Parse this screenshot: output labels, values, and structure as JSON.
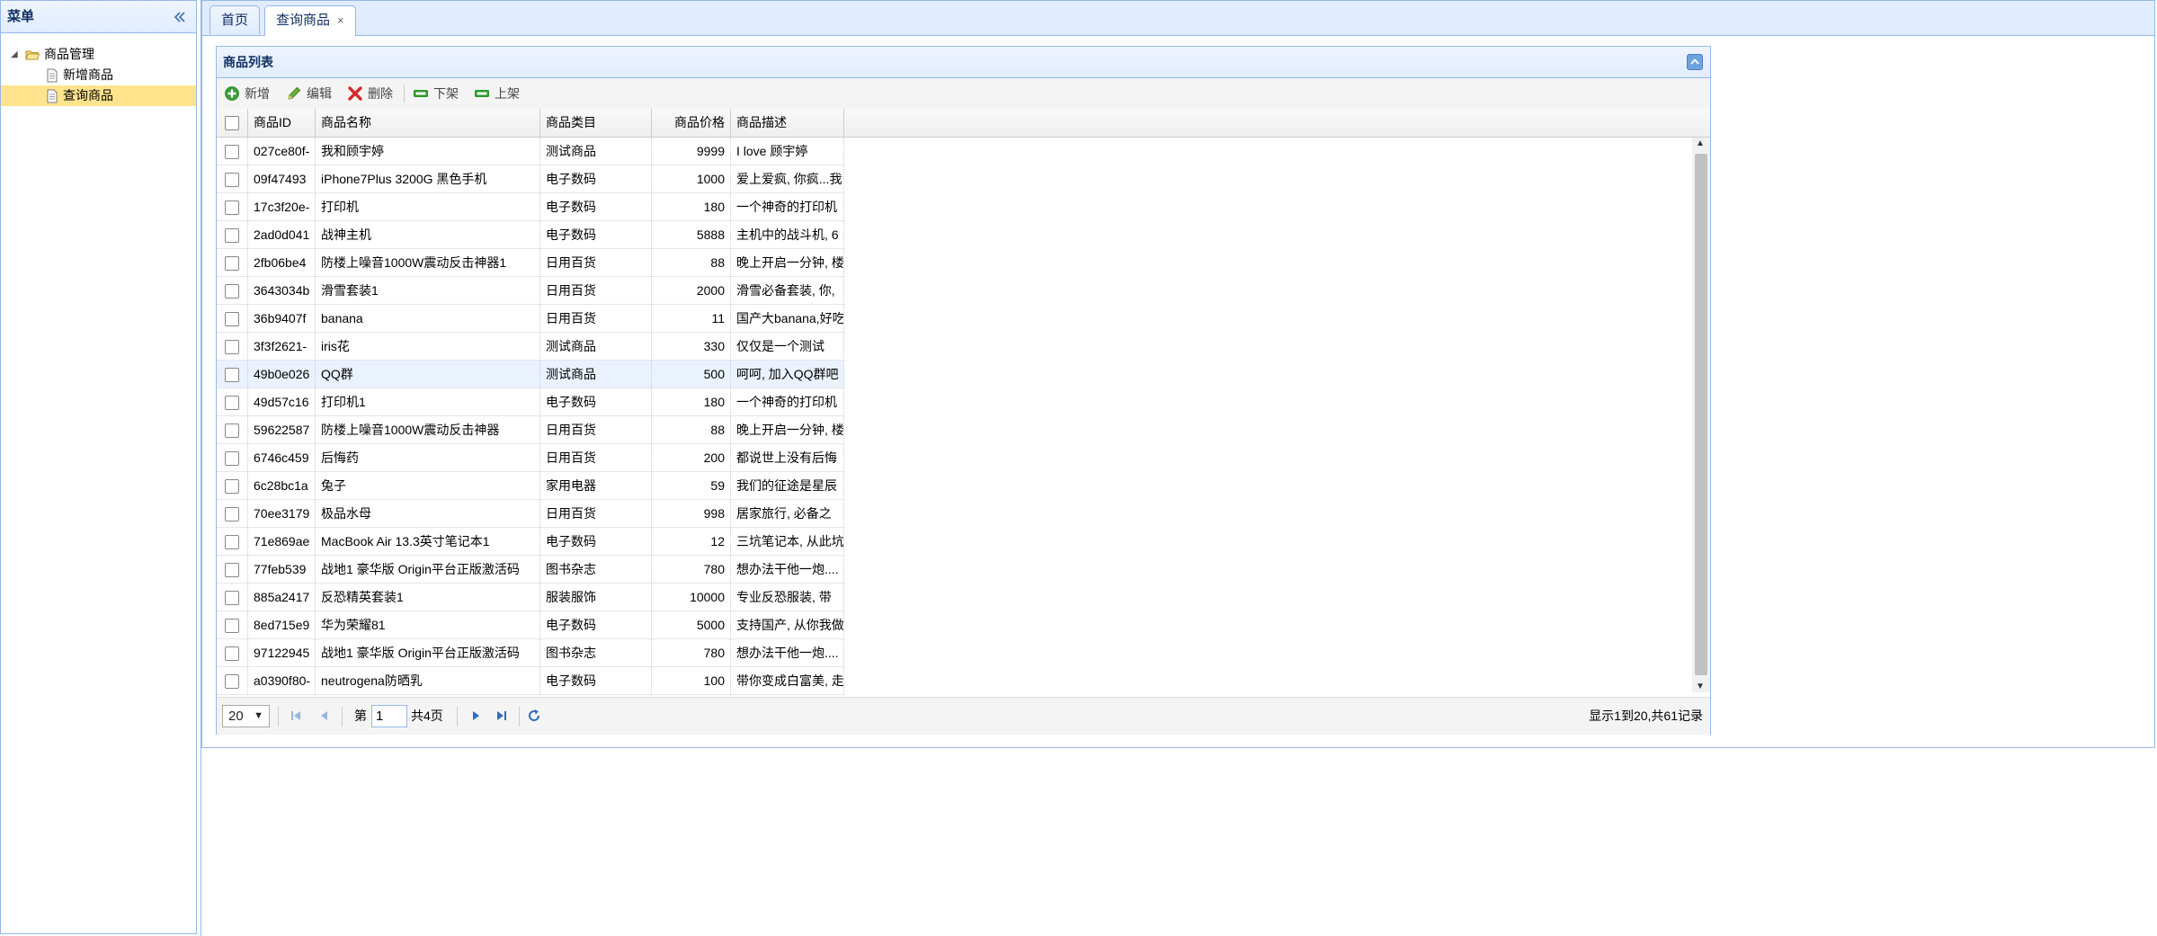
{
  "menu": {
    "title": "菜单",
    "tree": {
      "root_label": "商品管理",
      "children": [
        {
          "label": "新增商品"
        },
        {
          "label": "查询商品"
        }
      ]
    }
  },
  "tabs": [
    {
      "label": "首页"
    },
    {
      "label": "查询商品",
      "close": "×"
    }
  ],
  "grid": {
    "title": "商品列表",
    "toolbar": {
      "add": "新增",
      "edit": "编辑",
      "delete": "删除",
      "offshelf": "下架",
      "onshelf": "上架"
    },
    "columns": {
      "id": "商品ID",
      "name": "商品名称",
      "category": "商品类目",
      "price": "商品价格",
      "desc": "商品描述"
    },
    "rows": [
      {
        "id": "027ce80f-",
        "name": "我和顾宇婷",
        "category": "测试商品",
        "price": "9999",
        "desc": "I love 顾宇婷"
      },
      {
        "id": "09f47493",
        "name": "iPhone7Plus 3200G 黑色手机",
        "category": "电子数码",
        "price": "1000",
        "desc": "爱上爱疯, 你疯...我"
      },
      {
        "id": "17c3f20e-",
        "name": "打印机",
        "category": "电子数码",
        "price": "180",
        "desc": "一个神奇的打印机"
      },
      {
        "id": "2ad0d041",
        "name": "战神主机",
        "category": "电子数码",
        "price": "5888",
        "desc": "主机中的战斗机, 6"
      },
      {
        "id": "2fb06be4",
        "name": "防楼上噪音1000W震动反击神器1",
        "category": "日用百货",
        "price": "88",
        "desc": "晚上开启一分钟, 楼"
      },
      {
        "id": "3643034b",
        "name": "滑雪套装1",
        "category": "日用百货",
        "price": "2000",
        "desc": "滑雪必备套装, 你,"
      },
      {
        "id": "36b9407f",
        "name": "banana",
        "category": "日用百货",
        "price": "11",
        "desc": "国产大banana,好吃"
      },
      {
        "id": "3f3f2621-",
        "name": "iris花",
        "category": "测试商品",
        "price": "330",
        "desc": "仅仅是一个测试"
      },
      {
        "id": "49b0e026",
        "name": "QQ群",
        "category": "测试商品",
        "price": "500",
        "desc": "呵呵, 加入QQ群吧"
      },
      {
        "id": "49d57c16",
        "name": "打印机1",
        "category": "电子数码",
        "price": "180",
        "desc": "一个神奇的打印机"
      },
      {
        "id": "59622587",
        "name": "防楼上噪音1000W震动反击神器",
        "category": "日用百货",
        "price": "88",
        "desc": "晚上开启一分钟, 楼"
      },
      {
        "id": "6746c459",
        "name": "后悔药",
        "category": "日用百货",
        "price": "200",
        "desc": "都说世上没有后悔"
      },
      {
        "id": "6c28bc1a",
        "name": "兔子",
        "category": "家用电器",
        "price": "59",
        "desc": "我们的征途是星辰"
      },
      {
        "id": "70ee3179",
        "name": "极品水母",
        "category": "日用百货",
        "price": "998",
        "desc": "居家旅行, 必备之"
      },
      {
        "id": "71e869ae",
        "name": "MacBook Air 13.3英寸笔记本1",
        "category": "电子数码",
        "price": "12",
        "desc": "三坑笔记本, 从此坑"
      },
      {
        "id": "77feb539",
        "name": "战地1 豪华版 Origin平台正版激活码",
        "category": "图书杂志",
        "price": "780",
        "desc": "想办法干他一炮...."
      },
      {
        "id": "885a2417",
        "name": "反恐精英套装1",
        "category": "服装服饰",
        "price": "10000",
        "desc": "专业反恐服装, 带"
      },
      {
        "id": "8ed715e9",
        "name": "华为荣耀81",
        "category": "电子数码",
        "price": "5000",
        "desc": "支持国产, 从你我做"
      },
      {
        "id": "97122945",
        "name": "战地1 豪华版 Origin平台正版激活码",
        "category": "图书杂志",
        "price": "780",
        "desc": "想办法干他一炮...."
      },
      {
        "id": "a0390f80-",
        "name": "neutrogena防晒乳",
        "category": "电子数码",
        "price": "100",
        "desc": "带你变成白富美, 走"
      }
    ],
    "pager": {
      "page_size": "20",
      "page_prefix": "第",
      "page_value": "1",
      "page_total": "共4页",
      "summary": "显示1到20,共61记录"
    }
  },
  "colors": {
    "border": "#95b8e7",
    "header_bg": "#e0ecff",
    "selected": "#ffe48d",
    "hover_row": "#eaf2ff"
  }
}
